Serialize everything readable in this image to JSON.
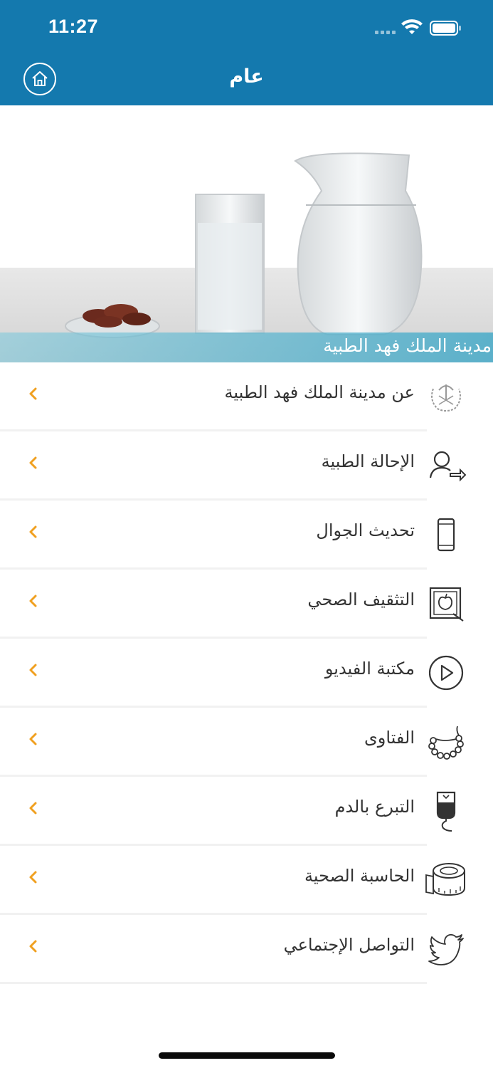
{
  "status_bar": {
    "time": "11:27"
  },
  "nav": {
    "title": "عام",
    "home_icon": "home-icon"
  },
  "banner": {
    "caption": "مدينة الملك فهد الطبية"
  },
  "colors": {
    "header": "#1479ae",
    "chevron": "#f0a020",
    "text": "#333333"
  },
  "menu": [
    {
      "label": "عن مدينة الملك فهد الطبية",
      "icon": "emblem-icon"
    },
    {
      "label": "الإحالة الطبية",
      "icon": "referral-icon"
    },
    {
      "label": "تحديث الجوال",
      "icon": "mobile-icon"
    },
    {
      "label": "التثقيف الصحي",
      "icon": "health-education-icon"
    },
    {
      "label": "مكتبة الفيديو",
      "icon": "play-icon"
    },
    {
      "label": "الفتاوى",
      "icon": "prayer-beads-icon"
    },
    {
      "label": "التبرع بالدم",
      "icon": "blood-bag-icon"
    },
    {
      "label": "الحاسبة الصحية",
      "icon": "measuring-tape-icon"
    },
    {
      "label": "التواصل الإجتماعي",
      "icon": "twitter-icon"
    }
  ]
}
